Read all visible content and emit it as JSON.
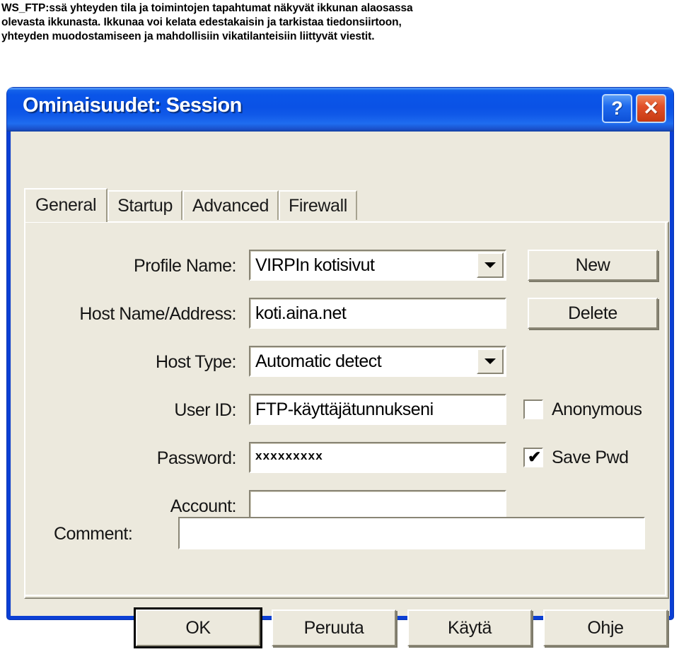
{
  "intro": {
    "paragraph": "WS_FTP:ssä yhteyden tila ja toimintojen tapahtumat näkyvät ikkunan alaosassa olevasta ikkunasta. Ikkunaa voi kelata edestakaisin ja tarkistaa tiedonsiirtoon, yhteyden muodostamiseen ja mahdollisiin vikatilanteisiin liittyvät viestit."
  },
  "dialog": {
    "title": "Ominaisuudet: Session",
    "titlebar": {
      "help_label": "?",
      "close_label": "✕",
      "gradient_color": "#0a52e6"
    },
    "tabs": [
      {
        "label": "General",
        "selected": true
      },
      {
        "label": "Startup",
        "selected": false
      },
      {
        "label": "Advanced",
        "selected": false
      },
      {
        "label": "Firewall",
        "selected": false
      }
    ],
    "form": {
      "profile_name": {
        "label": "Profile Name:",
        "value": "VIRPIn kotisivut",
        "type": "combobox"
      },
      "host_name": {
        "label": "Host Name/Address:",
        "value": "koti.aina.net",
        "type": "text"
      },
      "host_type": {
        "label": "Host Type:",
        "value": "Automatic detect",
        "type": "combobox"
      },
      "user_id": {
        "label": "User ID:",
        "value": "FTP-käyttäjätunnukseni",
        "type": "text"
      },
      "password": {
        "label": "Password:",
        "value": "xxxxxxxxx",
        "type": "password"
      },
      "account": {
        "label": "Account:",
        "value": "",
        "type": "text"
      },
      "comment": {
        "label": "Comment:",
        "value": "",
        "type": "text"
      }
    },
    "side_buttons": {
      "new": "New",
      "delete": "Delete"
    },
    "checkboxes": {
      "anonymous": {
        "label": "Anonymous",
        "checked": false,
        "mark": ""
      },
      "save_pwd": {
        "label": "Save Pwd",
        "checked": true,
        "mark": "✔"
      }
    },
    "footer_buttons": {
      "ok": "OK",
      "cancel": "Peruuta",
      "apply": "Käytä",
      "help": "Ohje"
    }
  }
}
